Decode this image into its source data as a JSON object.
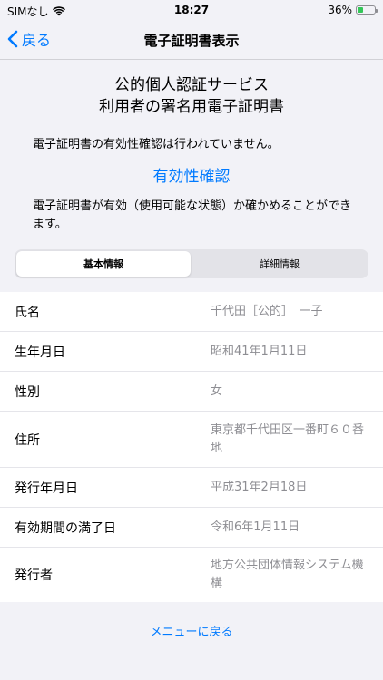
{
  "status_bar": {
    "carrier": "SIMなし",
    "time": "18:27",
    "battery_percent": "36%",
    "battery_level": 0.36,
    "battery_color": "#34c759"
  },
  "nav": {
    "back_label": "戻る",
    "title": "電子証明書表示"
  },
  "header": {
    "title_line1": "公的個人認証サービス",
    "title_line2": "利用者の署名用電子証明書",
    "validity_message": "電子証明書の有効性確認は行われていません。",
    "validity_link": "有効性確認",
    "validity_desc": "電子証明書が有効（使用可能な状態）か確かめることができます。"
  },
  "tabs": {
    "basic": "基本情報",
    "detail": "詳細情報"
  },
  "info": [
    {
      "label": "氏名",
      "value": "千代田［公的］　一子"
    },
    {
      "label": "生年月日",
      "value": "昭和41年1月11日"
    },
    {
      "label": "性別",
      "value": "女"
    },
    {
      "label": "住所",
      "value": "東京都千代田区一番町６０番地"
    },
    {
      "label": "発行年月日",
      "value": "平成31年2月18日"
    },
    {
      "label": "有効期間の満了日",
      "value": "令和6年1月11日"
    },
    {
      "label": "発行者",
      "value": "地方公共団体情報システム機構"
    }
  ],
  "footer": {
    "menu_back": "メニューに戻る"
  },
  "colors": {
    "accent": "#007aff",
    "background": "#f2f2f7"
  }
}
